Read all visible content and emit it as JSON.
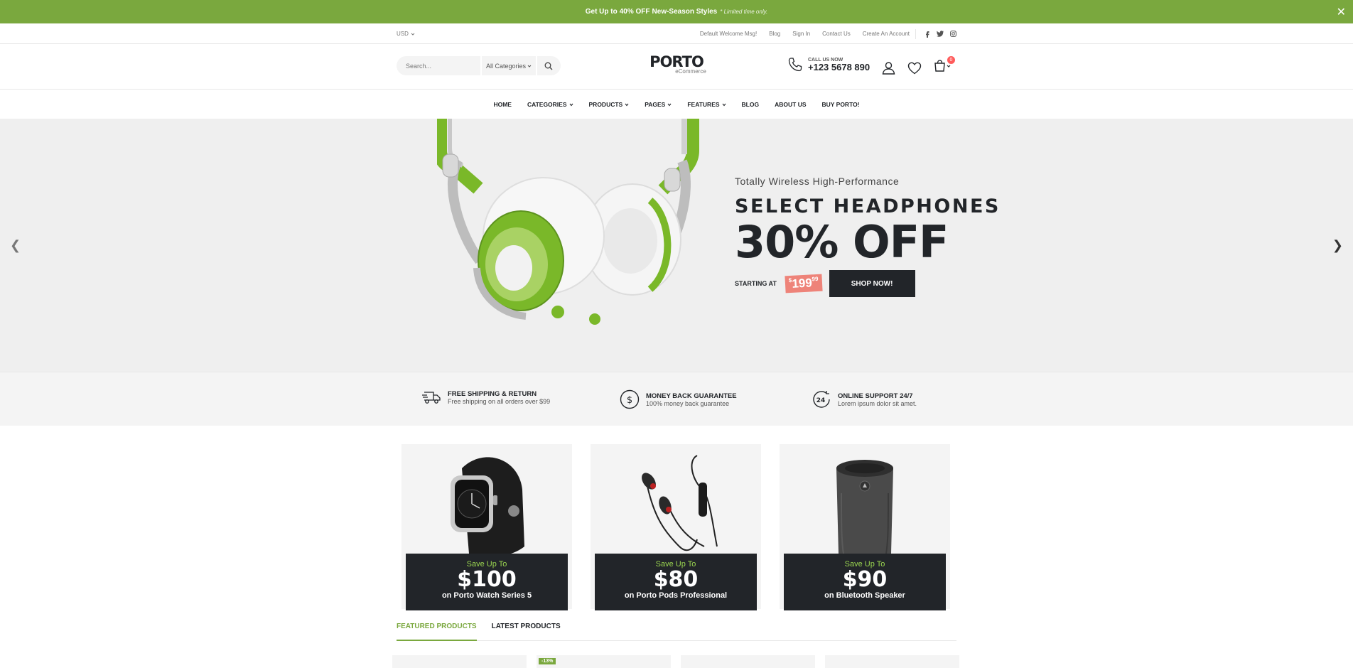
{
  "promo": {
    "text_before": "Get Up to",
    "highlight": "40% OFF",
    "text_after": "New-Season Styles",
    "note": "* Limited time only.",
    "close": "✕"
  },
  "header_top": {
    "currency": "USD",
    "links": [
      "Default Welcome Msg!",
      "Blog",
      "Sign In",
      "Contact Us",
      "Create An Account"
    ],
    "socials": [
      "facebook-icon",
      "twitter-icon",
      "instagram-icon"
    ]
  },
  "header": {
    "search_placeholder": "Search...",
    "category": "All Categories",
    "logo": "PORTO",
    "logo_sub": "eCommerce",
    "call_label": "CALL US NOW",
    "call_number": "+123 5678 890",
    "cart_count": "0"
  },
  "nav": [
    "HOME",
    "CATEGORIES",
    "PRODUCTS",
    "PAGES",
    "FEATURES",
    "BLOG",
    "ABOUT US",
    "BUY PORTO!"
  ],
  "hero": {
    "pre": "Totally Wireless High-Performance",
    "heading": "SELECT HEADPHONES",
    "discount": "30% OFF",
    "starting": "STARTING AT",
    "price_currency": "$",
    "price_main": "199",
    "price_cents": "99",
    "button": "SHOP NOW!"
  },
  "info": [
    {
      "title": "FREE SHIPPING & RETURN",
      "desc": "Free shipping on all orders over $99"
    },
    {
      "title": "MONEY BACK GUARANTEE",
      "desc": "100% money back guarantee"
    },
    {
      "title": "ONLINE SUPPORT 24/7",
      "desc": "Lorem ipsum dolor sit amet."
    }
  ],
  "banners": [
    {
      "save": "Save Up To",
      "amount": "$100",
      "on": "on Porto Watch Series 5"
    },
    {
      "save": "Save Up To",
      "amount": "$80",
      "on": "on Porto Pods Professional"
    },
    {
      "save": "Save Up To",
      "amount": "$90",
      "on": "on Bluetooth Speaker"
    }
  ],
  "tabs": [
    "FEATURED PRODUCTS",
    "LATEST PRODUCTS"
  ],
  "products": [
    {
      "discount": ""
    },
    {
      "discount": "-13%"
    },
    {
      "discount": ""
    },
    {
      "discount": ""
    }
  ],
  "colors": {
    "accent": "#7aa83e",
    "dark": "#222529",
    "sale": "#ee8379",
    "badge": "#ff5b5b"
  }
}
